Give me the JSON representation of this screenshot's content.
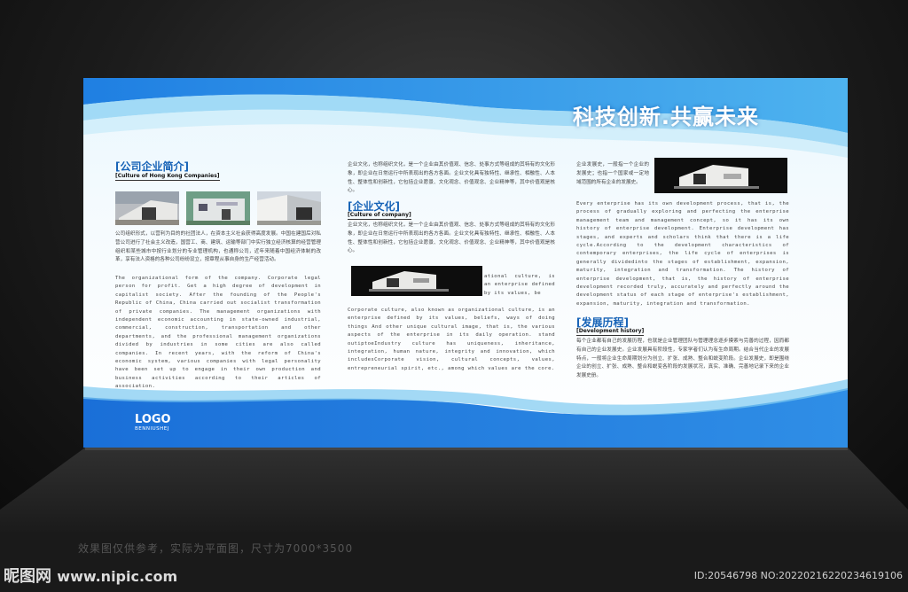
{
  "board": {
    "slogan": "科技创新.共赢未来",
    "logo": {
      "title": "LOGO",
      "subtitle": "BENNIUSHEJ"
    },
    "col1": {
      "title": "[公司企业简介]",
      "subtitle": "[Culture of Hong Kong Companies]",
      "cn_text": "公司组织形式，以营利为目的的社团法人，在资本主义社会获得高度发展。中国在建国后对私营公司进行了社会主义改造，国营工、商、建筑、运输等部门中实行独立经济核算的经营管理组织和某些城市中按行业划分的专业管理机构，也通称公司，近年来随着中国经济体制的改革，享有法人资格的各种公司纷纷设立，按章程从事自身的生产经营活动。",
      "en_text": "The organizational form of the company. Corporate legal person for profit. Get a high degree of development in capitalist society. After the founding of the People's Republic of China, China carried out socialist transformation of private companies. The management organizations with independent economic accounting in state-owned industrial, commercial, construction, transportation and other departments, and the professional management organizations divided by industries in some cities are also called companies. In recent years, with the reform of China's economic system, various companies with legal personality have been set up to engage in their own production and business activities according to their articles of association."
    },
    "col2": {
      "cn_top": "企业文化，也称组织文化，是一个企业由其价值观、信念、处事方式等组成的其特有的文化形象，即企业在日常运行中所表现出的各方各面。企业文化具有独特性、继承性、相融性、人本性、整体性和创新性，它包括企业愿景、文化观念、价值观念、企业精神等，其中价值观是核心。",
      "title": "[企业文化]",
      "subtitle": "[Culture of company]",
      "cn_text": "企业文化，也称组织文化，是一个企业由其价值观、信念、处事方式等组成的其特有的文化形象，即企业在日常运行中所表现出的各方各面。企业文化具有独特性、继承性、相融性、人本性、整体性和创新性，它包括企业愿景、文化观念、价值观念、企业精神等，其中价值观是核心。",
      "side_text": "ational culture, is an enterprise defined by its values, be",
      "en_text": "Corporate culture, also known as organizational culture, is an enterprise defined by its values, beliefs, ways of doing things And other unique cultural image, that is, the various aspects of the enterprise in its daily operation. stand outiptoeIndustry culture has uniqueness, inheritance, integration, human nature, integrity and innovation, which includesCorporate vision, cultural concepts, values, entrepreneurial spirit, etc., among which values are the core."
    },
    "col3": {
      "cn_top": "企业发展史，一般指一个企业的发展史；也指一个国家或一定地域范围的所有企业的发展史。",
      "en_text": "Every enterprise has its own development process, that is, the process of gradually exploring and perfecting the enterprise management team and management concept, so it has its own history of enterprise development. Enterprise development has stages, and experts and scholars think that there is a life cycle.According to the development characteristics of contemporary enterprises, the life cycle of enterprises is generally dividedinto the stages of establishment, expansion, maturity, integration and transformation. The history of enterprise development, that is, the history of enterprise development recorded truly, accurately and perfectly around the development status of each stage of enterprise's establishment, expansion, maturity, integration and transformation.",
      "title": "[发展历程]",
      "subtitle": "[Development history]",
      "cn_text": "每个企业都有自己的发展历程，也就是企业管理团队与管理理念逐步摸索与完善的过程，因而都有自己的企业发展史。企业发展具有阶段性，专家学者们认为有生命周期。结合当代企业的发展特点，一般将企业生命周期划分为创立、扩张、成熟、整合和蜕变阶段。企业发展史，即是围绕企业的创立、扩张、成熟、整合和蜕变各阶段的发展状况，真实、准确、完善地记录下来的企业发展史册。"
    }
  },
  "footer": {
    "note": "效果图仅供参考，实际为平面图，尺寸为7000*3500",
    "site_name": "昵图网",
    "site_url": "www.nipic.com",
    "id_text": "ID:20546798 NO:20220216220234619106"
  },
  "colors": {
    "brand_blue": "#1763b7",
    "wave_blue": "#1e7be0",
    "wave_light": "#5fb9ee"
  }
}
